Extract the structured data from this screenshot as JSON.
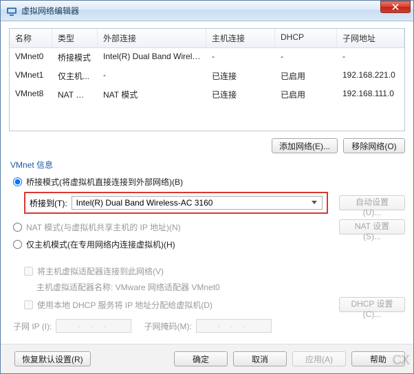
{
  "titlebar": {
    "title": "虚拟网络编辑器"
  },
  "table": {
    "headers": {
      "name": "名称",
      "type": "类型",
      "ext": "外部连接",
      "host": "主机连接",
      "dhcp": "DHCP",
      "subnet": "子网地址"
    },
    "rows": [
      {
        "name": "VMnet0",
        "type": "桥接模式",
        "ext": "Intel(R) Dual Band Wireless-...",
        "host": "-",
        "dhcp": "-",
        "subnet": "-"
      },
      {
        "name": "VMnet1",
        "type": "仅主机...",
        "ext": "-",
        "host": "已连接",
        "dhcp": "已启用",
        "subnet": "192.168.221.0"
      },
      {
        "name": "VMnet8",
        "type": "NAT 模式",
        "ext": "NAT 模式",
        "host": "已连接",
        "dhcp": "已启用",
        "subnet": "192.168.111.0"
      }
    ]
  },
  "buttons": {
    "add_network": "添加网络(E)...",
    "remove_network": "移除网络(O)",
    "auto_set": "自动设置(U)...",
    "nat_set": "NAT 设置(S)...",
    "dhcp_set": "DHCP 设置(C)...",
    "restore": "恢复默认设置(R)",
    "ok": "确定",
    "cancel": "取消",
    "apply": "应用(A)",
    "help": "帮助"
  },
  "group": {
    "title": "VMnet 信息",
    "bridge_radio": "桥接模式(将虚拟机直接连接到外部网络)(B)",
    "bridge_to_label": "桥接到(T):",
    "bridge_to_value": "Intel(R) Dual Band Wireless-AC 3160",
    "nat_radio": "NAT 模式(与虚拟机共享主机的 IP 地址)(N)",
    "hostonly_radio": "仅主机模式(在专用网络内连接虚拟机)(H)",
    "connect_host_check": "将主机虚拟适配器连接到此网络(V)",
    "adapter_name_line": "主机虚拟适配器名称: VMware 网络适配器 VMnet0",
    "dhcp_check": "使用本地 DHCP 服务将 IP 地址分配给虚拟机(D)",
    "subnet_ip_label": "子网 IP (I):",
    "subnet_mask_label": "子网掩码(M):",
    "ip_placeholder": ". . ."
  },
  "watermark": "CX"
}
